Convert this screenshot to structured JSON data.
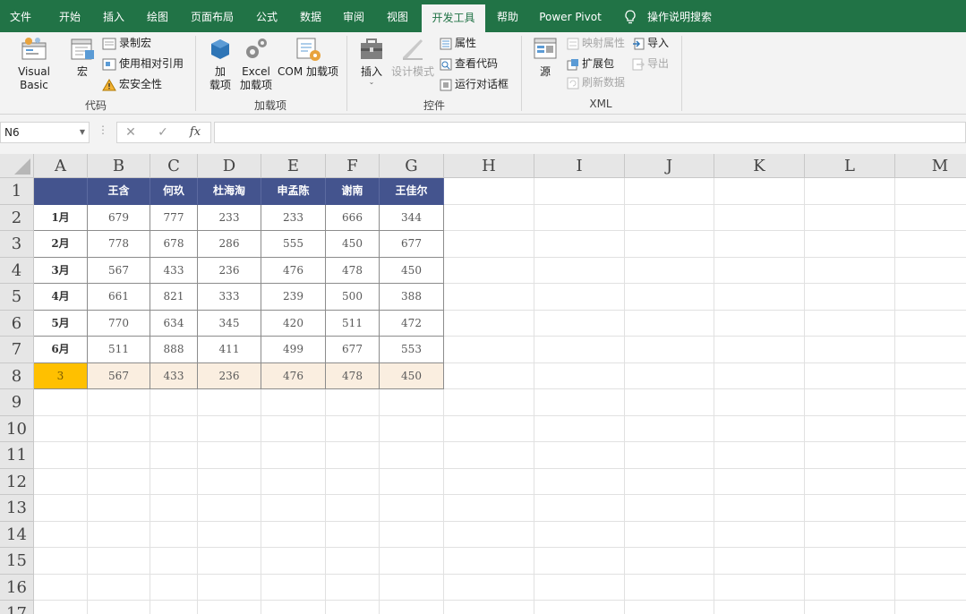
{
  "menu": {
    "tabs": [
      "文件",
      "开始",
      "插入",
      "绘图",
      "页面布局",
      "公式",
      "数据",
      "审阅",
      "视图",
      "开发工具",
      "帮助",
      "Power Pivot"
    ],
    "active_tab": "开发工具",
    "search_label": "操作说明搜索"
  },
  "ribbon": {
    "groups": {
      "code": {
        "label": "代码",
        "visual_basic": "Visual Basic",
        "macros": "宏",
        "record_macro": "录制宏",
        "relative_refs": "使用相对引用",
        "macro_security": "宏安全性"
      },
      "addins": {
        "label": "加载项",
        "addins_btn_line1": "加",
        "addins_btn_line2": "载项",
        "excel_addins_line1": "Excel",
        "excel_addins_line2": "加载项",
        "com_addins": "COM 加载项"
      },
      "controls": {
        "label": "控件",
        "insert": "插入",
        "design_mode": "设计模式",
        "properties": "属性",
        "view_code": "查看代码",
        "run_dialog": "运行对话框"
      },
      "xml": {
        "label": "XML",
        "source": "源",
        "map_properties": "映射属性",
        "expansion_packs": "扩展包",
        "refresh_data": "刷新数据",
        "import": "导入",
        "export": "导出"
      }
    }
  },
  "formula_bar": {
    "name_box": "N6",
    "formula": ""
  },
  "sheet": {
    "columns": [
      "A",
      "B",
      "C",
      "D",
      "E",
      "F",
      "G",
      "H",
      "I",
      "J",
      "K",
      "L",
      "M"
    ],
    "rows": [
      "1",
      "2",
      "3",
      "4",
      "5",
      "6",
      "7",
      "8",
      "9",
      "10",
      "11",
      "12",
      "13",
      "14",
      "15",
      "16",
      "17"
    ],
    "table": {
      "header": [
        "",
        "王含",
        "何玖",
        "杜海淘",
        "申孟陈",
        "谢南",
        "王佳尔"
      ],
      "body": [
        [
          "1月",
          "679",
          "777",
          "233",
          "233",
          "666",
          "344"
        ],
        [
          "2月",
          "778",
          "678",
          "286",
          "555",
          "450",
          "677"
        ],
        [
          "3月",
          "567",
          "433",
          "236",
          "476",
          "478",
          "450"
        ],
        [
          "4月",
          "661",
          "821",
          "333",
          "239",
          "500",
          "388"
        ],
        [
          "5月",
          "770",
          "634",
          "345",
          "420",
          "511",
          "472"
        ],
        [
          "6月",
          "511",
          "888",
          "411",
          "499",
          "677",
          "553"
        ]
      ],
      "lookup_row": [
        "3",
        "567",
        "433",
        "236",
        "476",
        "478",
        "450"
      ]
    }
  },
  "colors": {
    "ribbon_green": "#217346",
    "table_header": "#44548e",
    "lookup_highlight": "#faeee0",
    "lookup_key": "#ffc000"
  }
}
